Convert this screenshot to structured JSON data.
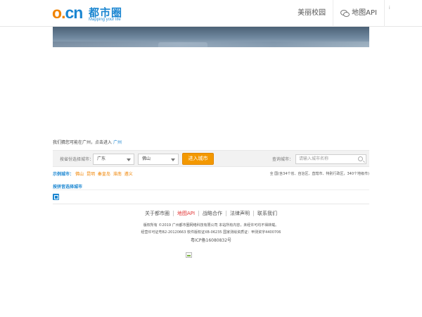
{
  "header": {
    "logo_mark": "o.cn",
    "logo_name": "都市圈",
    "logo_slogan": "Mapping your life",
    "nav": [
      "美丽校园",
      "地图API"
    ],
    "nav_edge": "i"
  },
  "location_line": {
    "prefix": "我们猜您可能在广州，点击进入",
    "city": "广州"
  },
  "search": {
    "province_label": "按省份选择城市：",
    "province_value": "广东",
    "city_value": "佛山",
    "enter_button": "进入城市",
    "query_label": "查询城市：",
    "query_placeholder": "请输入城市名称"
  },
  "examples": {
    "heading": "示例城市：",
    "cities": [
      "佛山",
      "昆明",
      "秦皇岛",
      "淮南",
      "遵义"
    ],
    "coverage": "全  国(含34个省、自治区、直辖市、特别行政区，340个地级市)"
  },
  "pinyin_title": "按拼音选择城市",
  "footer": {
    "links": [
      "关于都市圈",
      "地图API",
      "战略合作",
      "法律声明",
      "联系我们"
    ],
    "copyright": "版权所有 ©2019 广州都市圈网络科技有限公司 本站所有内容，未经许可均不得转载。",
    "licenses": "经营许可证粤B2-20120663 软件版权证XB-06235 国家测绘资质证：甲测资字4400706",
    "icp": "粤ICP备16080832号"
  },
  "colors": {
    "brand_blue": "#1b86d1",
    "brand_orange": "#f08300",
    "button_orange": "#f39800",
    "api_red": "#e23636"
  }
}
